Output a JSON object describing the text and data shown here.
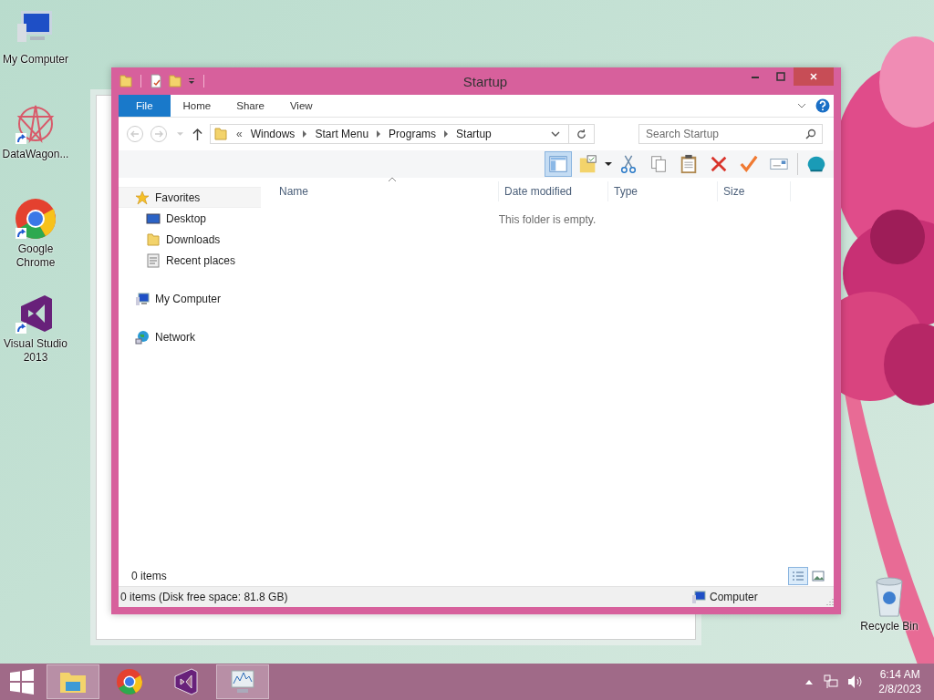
{
  "desktop_icons": [
    {
      "kind": "computer",
      "label": "My Computer",
      "shortcut": false
    },
    {
      "kind": "star",
      "label": "DataWagon...",
      "shortcut": true
    },
    {
      "kind": "chrome",
      "label": "Google Chrome",
      "shortcut": true
    },
    {
      "kind": "vs",
      "label": "Visual Studio 2013",
      "shortcut": true
    }
  ],
  "recycle_bin": {
    "label": "Recycle Bin"
  },
  "window": {
    "title": "Startup",
    "ribbon_tabs": [
      {
        "kind": "file",
        "label": "File"
      },
      {
        "kind": "tab",
        "label": "Home"
      },
      {
        "kind": "tab",
        "label": "Share"
      },
      {
        "kind": "tab",
        "label": "View"
      }
    ],
    "breadcrumb": {
      "overflow": "«",
      "items": [
        "Windows",
        "Start Menu",
        "Programs",
        "Startup"
      ]
    },
    "search": {
      "placeholder": "Search Startup"
    },
    "nav": [
      {
        "kind": "star",
        "label": "Favorites",
        "selected": true,
        "children": [
          {
            "kind": "desktop",
            "label": "Desktop",
            "selected": false
          },
          {
            "kind": "folder",
            "label": "Downloads",
            "selected": false
          },
          {
            "kind": "recent",
            "label": "Recent places",
            "selected": false
          }
        ]
      },
      {
        "kind": "computer",
        "label": "My Computer",
        "selected": false
      },
      {
        "kind": "network",
        "label": "Network",
        "selected": false
      }
    ],
    "columns": [
      "Name",
      "Date modified",
      "Type",
      "Size"
    ],
    "empty_message": "This folder is empty.",
    "item_count": "0 items",
    "view_buttons": [
      {
        "kind": "details",
        "selected": true
      },
      {
        "kind": "large",
        "selected": false
      }
    ],
    "status_bar": {
      "text": "0 items (Disk free space: 81.8 GB)",
      "location": "Computer"
    }
  },
  "taskbar": {
    "apps": [
      {
        "kind": "explorer",
        "running": true
      },
      {
        "kind": "chrome",
        "running": false
      },
      {
        "kind": "vs",
        "running": false
      },
      {
        "kind": "monitor",
        "running": true
      }
    ],
    "time": "6:14 AM",
    "date": "2/8/2023"
  }
}
